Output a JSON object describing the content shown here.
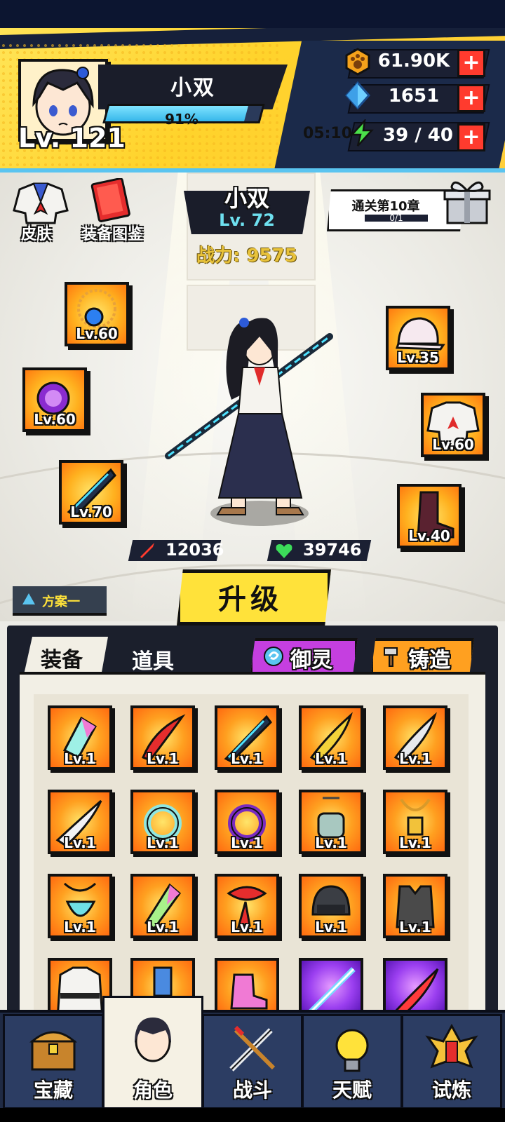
{
  "player": {
    "name": "小双",
    "level": "Lv. 121",
    "xp_percent": "91%",
    "xp_fraction": 0.91
  },
  "resources": {
    "gold": "61.90K",
    "gems": "1651",
    "energy": "39 / 40",
    "timer": "05:10"
  },
  "shortcuts": {
    "skin": "皮肤",
    "codex": "装备图鉴"
  },
  "character": {
    "name": "小双",
    "level": "Lv. 72",
    "power": "战力: 9575",
    "attack": "12036",
    "health": "39746"
  },
  "chapter_reward": {
    "title": "通关第10章",
    "progress": "0/1"
  },
  "equipped": {
    "necklace": "Lv.60",
    "ring": "Lv.60",
    "weapon": "Lv.70",
    "hat": "Lv.35",
    "armor": "Lv.60",
    "boots": "Lv.40"
  },
  "buttons": {
    "upgrade": "升级",
    "plan": "方案一",
    "spirit": "御灵",
    "forge": "铸造"
  },
  "tabs": {
    "equipment": "装备",
    "items": "道具"
  },
  "inventory": [
    {
      "icon": "crystal-kite-icon",
      "level": "Lv.1"
    },
    {
      "icon": "red-scimitar-icon",
      "level": "Lv.1"
    },
    {
      "icon": "jagged-blade-icon",
      "level": "Lv.1"
    },
    {
      "icon": "golden-blade-icon",
      "level": "Lv.1"
    },
    {
      "icon": "silver-blade-icon",
      "level": "Lv.1"
    },
    {
      "icon": "white-blade-icon",
      "level": "Lv.1"
    },
    {
      "icon": "jade-ring-icon",
      "level": "Lv.1"
    },
    {
      "icon": "purple-ring-icon",
      "level": "Lv.1"
    },
    {
      "icon": "skull-pendant-icon",
      "level": "Lv.1"
    },
    {
      "icon": "gold-pendant-icon",
      "level": "Lv.1"
    },
    {
      "icon": "jade-pendant-icon",
      "level": "Lv.1"
    },
    {
      "icon": "crystal-shard-icon",
      "level": "Lv.1"
    },
    {
      "icon": "red-scarf-icon",
      "level": "Lv.1"
    },
    {
      "icon": "helmet-icon",
      "level": "Lv.1"
    },
    {
      "icon": "vest-icon",
      "level": "Lv.1"
    },
    {
      "icon": "martial-robe-icon",
      "level": ""
    },
    {
      "icon": "blue-cuff-icon",
      "level": ""
    },
    {
      "icon": "roller-skate-icon",
      "level": ""
    },
    {
      "icon": "light-sword-icon",
      "level": ""
    },
    {
      "icon": "red-sword-icon",
      "level": ""
    }
  ],
  "nav": [
    {
      "label": "宝藏",
      "icon": "treasure-chest-icon"
    },
    {
      "label": "角色",
      "icon": "character-icon"
    },
    {
      "label": "战斗",
      "icon": "battle-swords-icon"
    },
    {
      "label": "天赋",
      "icon": "lightbulb-icon"
    },
    {
      "label": "试炼",
      "icon": "trial-emblem-icon"
    }
  ],
  "colors": {
    "accent_yellow": "#ffe23a",
    "header_blue": "#5ac4f0",
    "plus_red": "#ff3b2e",
    "panel_dark": "#1b1f2c"
  }
}
